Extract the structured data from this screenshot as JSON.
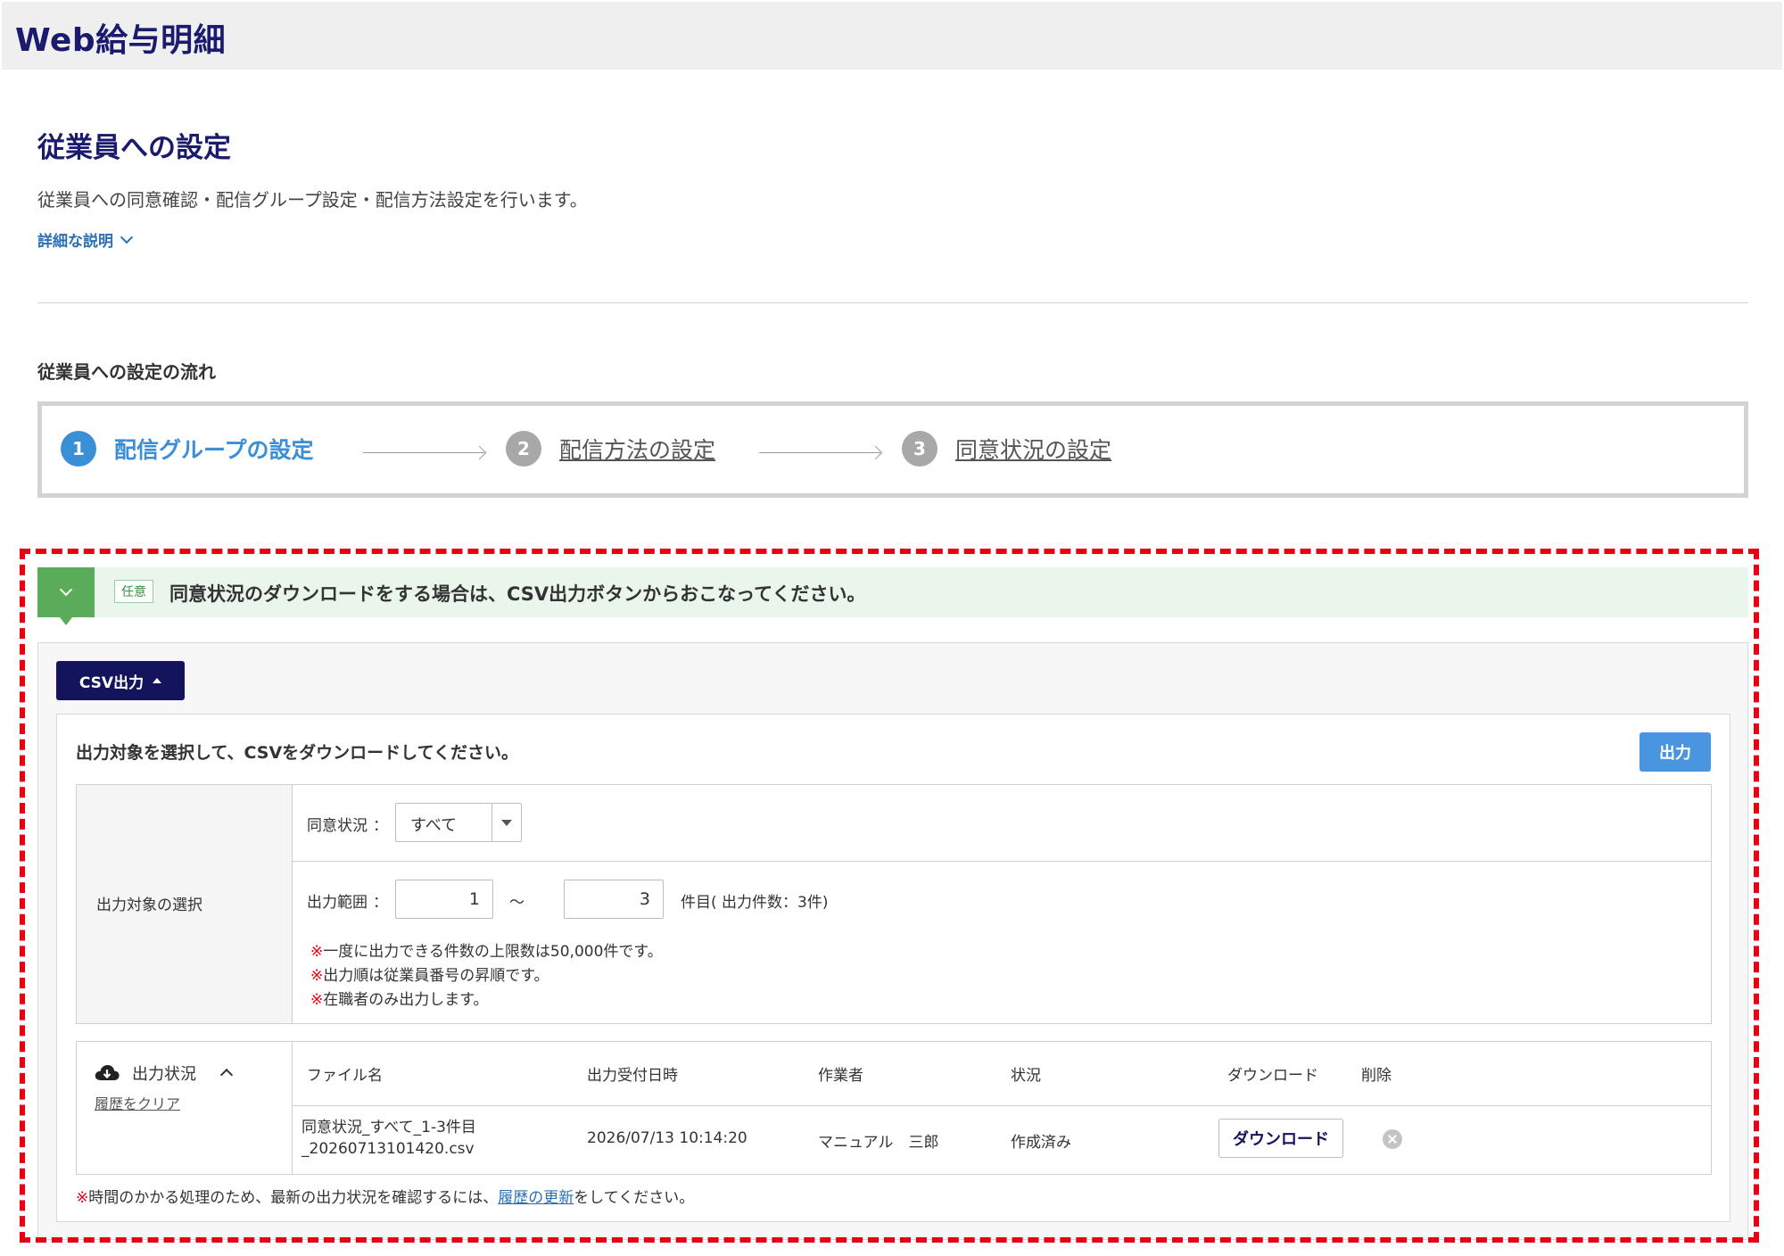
{
  "app": {
    "title": "Web給与明細"
  },
  "page": {
    "title": "従業員への設定",
    "description": "従業員への同意確認・配信グループ設定・配信方法設定を行います。",
    "detail_link": "詳細な説明"
  },
  "flow": {
    "title": "従業員への設定の流れ",
    "steps": [
      {
        "num": "1",
        "label": "配信グループの設定",
        "state": "active"
      },
      {
        "num": "2",
        "label": "配信方法の設定",
        "state": "link"
      },
      {
        "num": "3",
        "label": "同意状況の設定",
        "state": "link"
      }
    ]
  },
  "notice": {
    "badge": "任意",
    "text": "同意状況のダウンロードをする場合は、CSV出力ボタンからおこなってください。"
  },
  "csv_panel": {
    "toggle_label": "CSV出力",
    "instruction": "出力対象を選択して、CSVをダウンロードしてください。",
    "output_button": "出力",
    "selection": {
      "header": "出力対象の選択",
      "consent_label": "同意状況",
      "colon": "：",
      "consent_value": "すべて",
      "range_label": "出力範囲",
      "range_from": "1",
      "tilde": "～",
      "range_to": "3",
      "range_suffix": "件目( 出力件数：3件)",
      "notes": [
        "一度に出力できる件数の上限数は50,000件です。",
        "出力順は従業員番号の昇順です。",
        "在職者のみ出力します。"
      ],
      "note_mark": "※"
    },
    "history": {
      "label": "出力状況",
      "clear_link": "履歴をクリア",
      "columns": {
        "file": "ファイル名",
        "date": "出力受付日時",
        "worker": "作業者",
        "status": "状況",
        "download": "ダウンロード",
        "delete": "削除"
      },
      "rows": [
        {
          "file_line1": "同意状況_すべて_1-3件目",
          "file_line2": "_20260713101420.csv",
          "date": "2026/07/13 10:14:20",
          "worker": "マニュアル　三郎",
          "status": "作成済み",
          "download_button": "ダウンロード"
        }
      ]
    },
    "footer_note": {
      "mark": "※",
      "before": "時間のかかる処理のため、最新の出力状況を確認するには、",
      "link": "履歴の更新",
      "after": "をしてください。"
    }
  },
  "colors": {
    "brand_navy": "#1b1b6e",
    "step_active": "#3b8fd6",
    "notice_green": "#5aab5a",
    "highlight_red": "#e60012",
    "output_blue": "#4a95e0"
  }
}
